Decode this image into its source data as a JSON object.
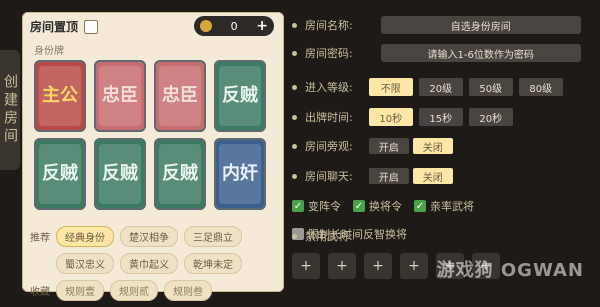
{
  "side_tab_text": "创建房间",
  "left": {
    "header": {
      "title": "房间置顶",
      "pin_checked": false
    },
    "counter_value": "0",
    "subtitle": "身份牌",
    "cards": [
      {
        "text": "主公",
        "color": "red"
      },
      {
        "text": "忠臣",
        "color": "pink"
      },
      {
        "text": "忠臣",
        "color": "pink"
      },
      {
        "text": "反贼",
        "color": "green"
      },
      {
        "text": "反贼",
        "color": "green"
      },
      {
        "text": "反贼",
        "color": "green"
      },
      {
        "text": "反贼",
        "color": "green"
      },
      {
        "text": "内奸",
        "color": "blue"
      }
    ],
    "recommend_label": "推荐",
    "recommend_items": [
      "经典身份",
      "楚汉相争",
      "三足鼎立"
    ],
    "recommend_items_2": [
      "蜀汉忠义",
      "黄巾起义",
      "乾坤未定"
    ],
    "fav_label": "收藏",
    "fav_items": [
      "规则壹",
      "规则贰",
      "规则叁"
    ]
  },
  "settings": {
    "room_name_label": "房间名称:",
    "room_name_value": "自选身份房间",
    "room_pwd_label": "房间密码:",
    "room_pwd_value": "请输入1-6位数作为密码",
    "level_label": "进入等级:",
    "level_options": [
      "不限",
      "20级",
      "50级",
      "80级"
    ],
    "level_selected_index": 0,
    "time_label": "出牌时间:",
    "time_options": [
      "10秒",
      "15秒",
      "20秒"
    ],
    "time_selected_index": 0,
    "spectate_label": "房间旁观:",
    "spectate_on": "开启",
    "spectate_off": "关闭",
    "spectate_selected": "off",
    "chat_label": "房间聊天:",
    "chat_on": "开启",
    "chat_off": "关闭",
    "chat_selected": "off",
    "checkbox_items": [
      {
        "label": "变阵令",
        "checked": true
      },
      {
        "label": "换将令",
        "checked": true
      },
      {
        "label": "亲率武将",
        "checked": true
      },
      {
        "label": "限制长时间反智换将",
        "checked": false
      }
    ],
    "ban_label": "禁用武将:",
    "slots": [
      "+",
      "+",
      "+",
      "+",
      "+",
      "+"
    ]
  },
  "watermark": "游戏狗 OGWAN",
  "colors": {
    "bg": "#1d1a18",
    "parchment": "#f3ebd7",
    "accent": "#fde6a6"
  }
}
